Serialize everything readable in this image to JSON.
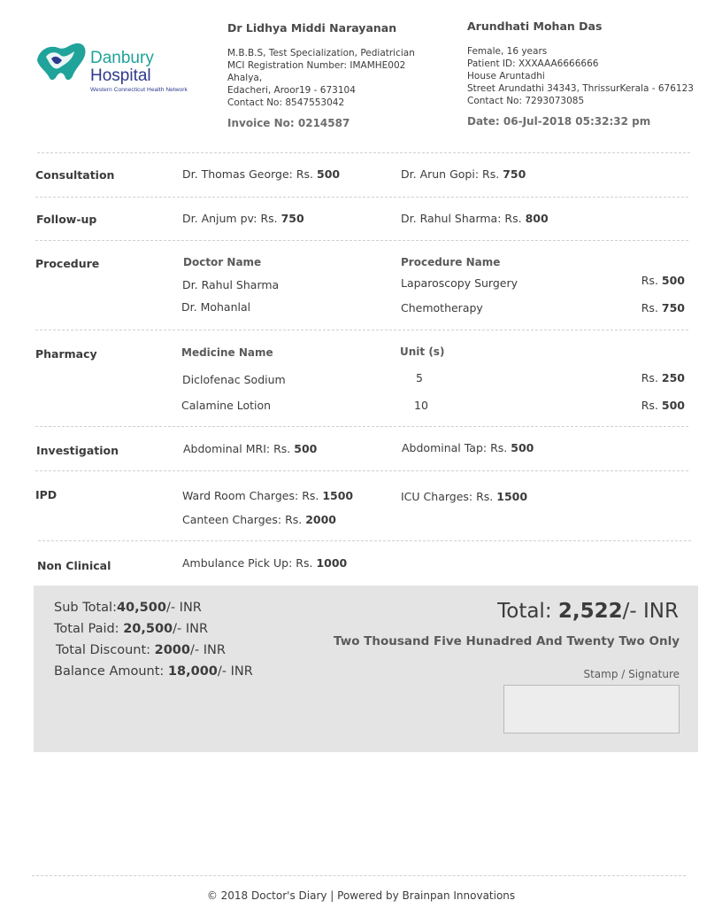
{
  "hospital": {
    "name_line1": "Danbury",
    "name_line2": "Hospital",
    "tagline": "Western Connecticut Health Network"
  },
  "doctor": {
    "name": "Dr Lidhya Middi Narayanan",
    "qualification": "M.B.B.S, Test Specialization, Pediatrician",
    "registration": "MCI Registration Number: IMAMHE002",
    "address_line1": "Ahalya,",
    "address_line2": "Edacheri, Aroor19 - 673104",
    "contact": "Contact No: 8547553042",
    "invoice": "Invoice No: 0214587"
  },
  "patient": {
    "name": "Arundhati Mohan Das",
    "gender_age": "Female, 16 years",
    "patient_id": "Patient ID: XXXAAA6666666",
    "house": "House Aruntadhi",
    "street": "Street Arundathi 34343, ThrissurKerala - 676123",
    "contact": "Contact No: 7293073085",
    "date": "Date: 06-Jul-2018 05:32:32 pm"
  },
  "currency": "Rs.",
  "sections": {
    "consultation": {
      "label": "Consultation",
      "items": [
        {
          "name": "Dr. Thomas George:",
          "amount": "500"
        },
        {
          "name": "Dr. Arun Gopi:",
          "amount": "750"
        }
      ]
    },
    "followup": {
      "label": "Follow-up",
      "items": [
        {
          "name": "Dr. Anjum pv:",
          "amount": "750"
        },
        {
          "name": "Dr. Rahul Sharma:",
          "amount": "800"
        }
      ]
    },
    "procedure": {
      "label": "Procedure",
      "doctor_header": "Doctor Name",
      "procedure_header": "Procedure Name",
      "doctors": [
        "Dr. Rahul Sharma",
        "Dr. Mohanlal"
      ],
      "procedures": [
        {
          "name": "Laparoscopy Surgery",
          "amount": "500"
        },
        {
          "name": "Chemotherapy",
          "amount": "750"
        }
      ]
    },
    "pharmacy": {
      "label": "Pharmacy",
      "medicine_header": "Medicine Name",
      "unit_header": "Unit (s)",
      "items": [
        {
          "name": "Diclofenac Sodium",
          "units": "5",
          "amount": "250"
        },
        {
          "name": "Calamine Lotion",
          "units": "10",
          "amount": "500"
        }
      ]
    },
    "investigation": {
      "label": "Investigation",
      "items": [
        {
          "name": "Abdominal MRI:",
          "amount": "500"
        },
        {
          "name": "Abdominal Tap:",
          "amount": "500"
        }
      ]
    },
    "ipd": {
      "label": "IPD",
      "items": [
        {
          "name": "Ward Room Charges:",
          "amount": "1500"
        },
        {
          "name": "ICU Charges:",
          "amount": "1500"
        },
        {
          "name": "Canteen Charges:",
          "amount": "2000"
        }
      ]
    },
    "nonclinical": {
      "label": "Non Clinical",
      "items": [
        {
          "name": "Ambulance Pick Up:",
          "amount": "1000"
        }
      ]
    }
  },
  "summary": {
    "subtotal_label": "Sub Total:",
    "subtotal": "40,500",
    "paid_label": "Total Paid:",
    "paid": "20,500",
    "discount_label": "Total Discount:",
    "discount": "2000",
    "balance_label": "Balance Amount:",
    "balance": "18,000",
    "suffix": "/- INR",
    "total_label": "Total:",
    "total": "2,522",
    "total_words": "Two Thousand Five Hunadred And Twenty Two Only",
    "stamp_label": "Stamp / Signature"
  },
  "footer": "© 2018 Doctor's Diary | Powered by Brainpan Innovations"
}
